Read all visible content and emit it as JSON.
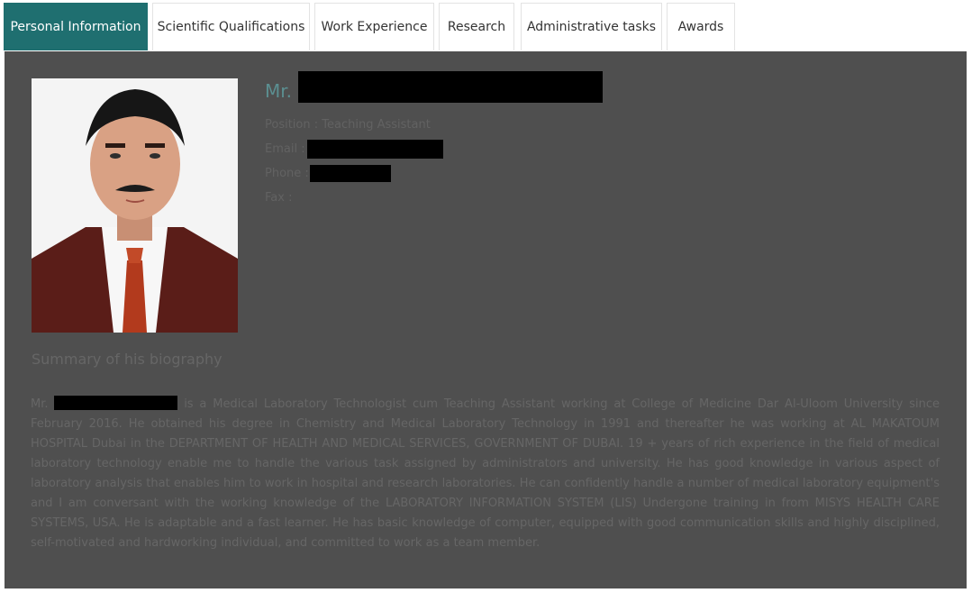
{
  "tabs": [
    {
      "label": "Personal Information",
      "active": true
    },
    {
      "label": "Scientific Qualifications",
      "active": false
    },
    {
      "label": "Work Experience",
      "active": false
    },
    {
      "label": "Research",
      "active": false
    },
    {
      "label": "Administrative tasks",
      "active": false
    },
    {
      "label": "Awards",
      "active": false
    }
  ],
  "profile": {
    "name_prefix": "Mr.",
    "position_label": "Position :",
    "position_value": "Teaching Assistant",
    "email_label": "Email :",
    "phone_label": "Phone :",
    "fax_label": "Fax :"
  },
  "summary": {
    "title": "Summary of his biography",
    "bio_prefix": "Mr.",
    "bio_text": "is a Medical Laboratory Technologist cum Teaching Assistant working at College of Medicine Dar Al-Uloom University since February 2016. He obtained his degree in Chemistry and Medical Laboratory Technology in 1991 and thereafter he was working at AL MAKATOUM HOSPITAL Dubai in the DEPARTMENT OF HEALTH AND MEDICAL SERVICES, GOVERNMENT OF DUBAI. 19 + years of rich experience in the field of medical laboratory technology enable me to handle the various task assigned by administrators and university. He has good knowledge in various aspect of laboratory analysis that enables him to work in hospital and research laboratories. He can confidently handle a number of medical laboratory equipment's and I am conversant with the working knowledge of the LABORATORY INFORMATION SYSTEM (LIS) Undergone training in from MISYS HEALTH CARE SYSTEMS, USA. He is adaptable and a fast learner. He has basic knowledge of computer, equipped with good communication skills and highly disciplined, self-motivated and hardworking individual, and committed to work as a team member."
  },
  "colors": {
    "accent": "#1f6f70",
    "panel_bg": "#4f4f4f",
    "text_muted": "#626262"
  }
}
